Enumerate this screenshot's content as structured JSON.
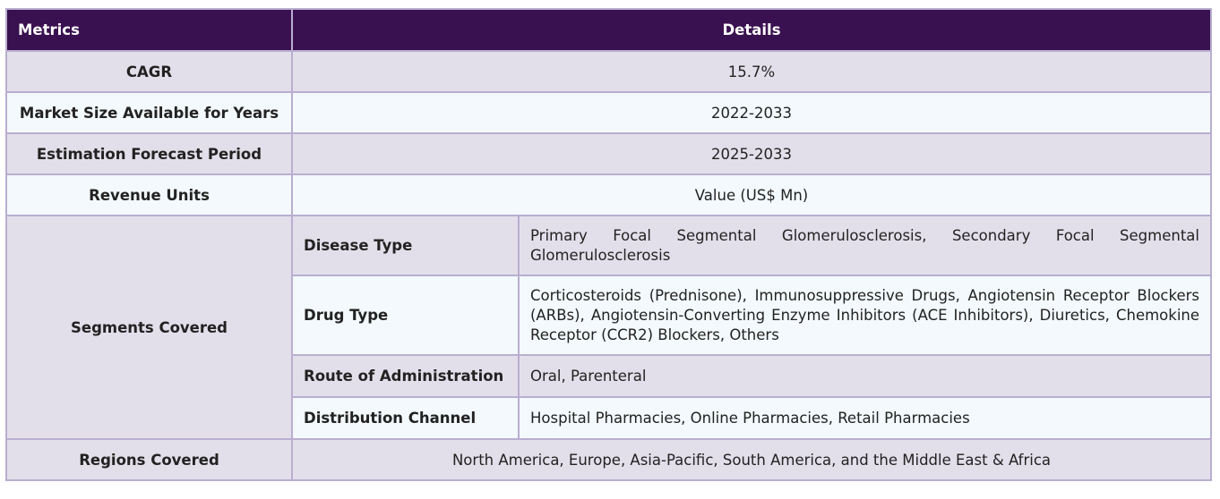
{
  "header": {
    "metrics": "Metrics",
    "details": "Details"
  },
  "rows": [
    {
      "label": "CAGR",
      "value": "15.7%"
    },
    {
      "label": "Market Size Available for Years",
      "value": "2022-2033"
    },
    {
      "label": "Estimation Forecast Period",
      "value": "2025-2033"
    },
    {
      "label": "Revenue Units",
      "value": "Value (US$ Mn)"
    }
  ],
  "segments": {
    "label": "Segments Covered",
    "items": [
      {
        "category": "Disease Type",
        "value": "Primary Focal Segmental Glomerulosclerosis, Secondary Focal Segmental Glomerulosclerosis"
      },
      {
        "category": "Drug Type",
        "value": "Corticosteroids (Prednisone), Immunosuppressive Drugs, Angiotensin Receptor Blockers (ARBs), Angiotensin-Converting Enzyme Inhibitors (ACE Inhibitors), Diuretics, Chemokine Receptor (CCR2) Blockers, Others"
      },
      {
        "category": "Route of Administration",
        "value": "Oral, Parenteral"
      },
      {
        "category": "Distribution Channel",
        "value": "Hospital Pharmacies, Online Pharmacies, Retail Pharmacies"
      }
    ]
  },
  "regions": {
    "label": "Regions Covered",
    "value": "North America, Europe, Asia-Pacific, South America, and the Middle East & Africa"
  }
}
